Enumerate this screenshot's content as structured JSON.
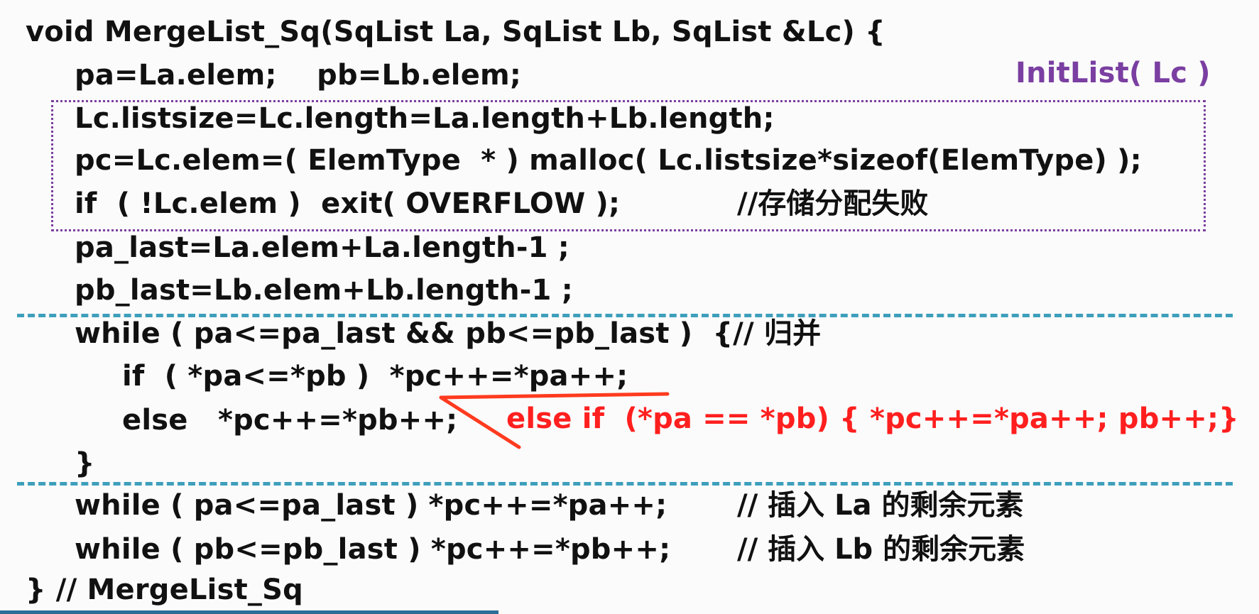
{
  "code": {
    "signature": "void MergeList_Sq(SqList La, SqList Lb, SqList &Lc) {",
    "line_pa_pb": "pa=La.elem;    pb=Lb.elem;",
    "line_listsize": "Lc.listsize=Lc.length=La.length+Lb.length;",
    "line_malloc": "pc=Lc.elem=( ElemType  * ) malloc( Lc.listsize*sizeof(ElemType) );",
    "line_if_overflow": "if  ( !Lc.elem )  exit( OVERFLOW );",
    "comment_overflow": "//存储分配失败",
    "line_pa_last": "pa_last=La.elem+La.length-1 ;",
    "line_pb_last": "pb_last=Lb.elem+Lb.length-1 ;",
    "line_while_merge": "while ( pa<=pa_last && pb<=pb_last )  {// 归并",
    "line_if_less": "if  ( *pa<=*pb )  *pc++=*pa++;",
    "line_else": "else   *pc++=*pb++;",
    "line_close_brace": "}",
    "line_while_pa": "while ( pa<=pa_last ) *pc++=*pa++;",
    "comment_pa": "// 插入 La 的剩余元素",
    "line_while_pb": "while ( pb<=pb_last ) *pc++=*pb++;",
    "comment_pb": "// 插入 Lb 的剩余元素",
    "line_end": "} // MergeList_Sq"
  },
  "annotations": {
    "initlist": "InitList( Lc )",
    "else_if": "else if  (*pa == *pb) { *pc++=*pa++; pb++;}"
  },
  "colors": {
    "background": "#fbfbfb",
    "text": "#111111",
    "initlist_purple": "#7a3fa1",
    "annotation_red": "#ff1f1f",
    "dashed_separator": "#3e9fbc",
    "bottom_strip": "#2b6f98"
  }
}
